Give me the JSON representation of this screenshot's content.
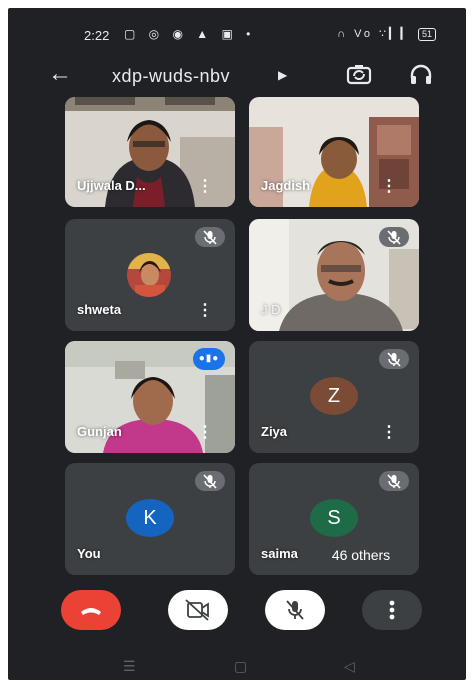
{
  "status_bar": {
    "time": "2:22",
    "left_icons": "▢ ◎ ◉ ▲ ▣ •",
    "right_icons": "∩ Vo ∵▎▎",
    "battery": "51"
  },
  "meeting": {
    "code": "xdp-wuds-nbv"
  },
  "participants": [
    {
      "name": "Ujjwala D...",
      "type": "video"
    },
    {
      "name": "Jagdish",
      "type": "video"
    },
    {
      "name": "shweta",
      "type": "photo-avatar",
      "muted": true
    },
    {
      "name": "J D",
      "type": "video",
      "muted": true
    },
    {
      "name": "Gunjan",
      "type": "video",
      "speaking": true
    },
    {
      "name": "Ziya",
      "type": "letter-avatar",
      "initial": "Z",
      "avatar_color": "#7b4b36",
      "muted": true
    },
    {
      "name": "You",
      "type": "letter-avatar",
      "initial": "K",
      "avatar_color": "#1565c0",
      "muted": true
    },
    {
      "name": "saima",
      "type": "letter-avatar",
      "initial": "S",
      "avatar_color": "#1e6b47",
      "muted": true
    }
  ],
  "others_label": "46 others",
  "controls": {
    "end_call_color": "#ea4335",
    "toggle_color": "#ffffff",
    "more_color": "#3c4043"
  },
  "icons": {
    "back": "arrow-back-icon",
    "switch_camera": "switch-camera-icon",
    "audio_output": "headphones-icon",
    "mic_off": "mic-off-icon",
    "video_off": "video-off-icon",
    "end_call": "phone-hangup-icon",
    "more": "more-vert-icon"
  },
  "nav_bar": {
    "menu": "☰",
    "home": "▢",
    "back": "◁"
  }
}
